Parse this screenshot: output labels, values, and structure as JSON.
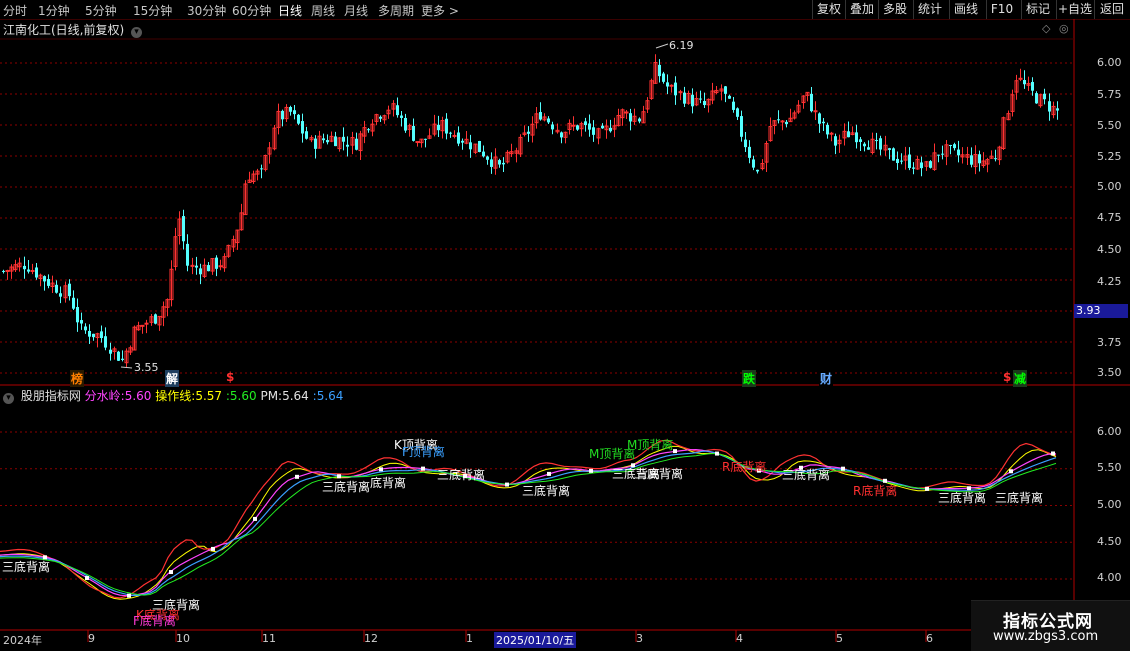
{
  "toolbar": {
    "periods": [
      "分时",
      "1分钟",
      "5分钟",
      "15分钟",
      "30分钟",
      "60分钟",
      "日线",
      "周线",
      "月线",
      "多周期",
      "更多 >"
    ],
    "active_period": "日线",
    "right_buttons": [
      "复权",
      "叠加",
      "多股",
      "统计",
      "画线",
      "F10",
      "标记",
      "+自选",
      "返回"
    ]
  },
  "main_panel": {
    "title": "江南化工(日线,前复权)",
    "price_labels": [
      "6.00",
      "5.75",
      "5.50",
      "5.25",
      "5.00",
      "4.75",
      "4.50",
      "4.25",
      "3.75",
      "3.50"
    ],
    "current_price": "3.93",
    "high_marker": "6.19",
    "low_marker": "3.55",
    "events": [
      {
        "text": "榜",
        "color": "#ff7f00",
        "bg": "#2a1a00"
      },
      {
        "text": "解",
        "color": "#ffffff",
        "bg": "#1f3f5f"
      },
      {
        "text": "$",
        "color": "#ff3030",
        "bg": "#000000"
      },
      {
        "text": "跌",
        "color": "#00ff00",
        "bg": "#1a3a1a"
      },
      {
        "text": "财",
        "color": "#66aaff",
        "bg": "#000000"
      },
      {
        "text": "$",
        "color": "#ff3030",
        "bg": "#000000"
      },
      {
        "text": "减",
        "color": "#00ff00",
        "bg": "#1a3a1a"
      }
    ]
  },
  "indicator_panel": {
    "name": "股朋指标网",
    "fsl_label": "分水岭:",
    "fsl_value": "5.60",
    "czx_label": "操作线:",
    "czx_value1": "5.57",
    "czx_sep": ":",
    "czx_value2": "5.60",
    "pm_label": "PM:",
    "pm_value1": "5.64",
    "pm_sep": ":",
    "pm_value2": "5.64",
    "y_labels": [
      "6.00",
      "5.50",
      "5.00",
      "4.50",
      "4.00"
    ],
    "divergence_labels": [
      {
        "text": "三底背离",
        "color": "#ffffff"
      },
      {
        "text": "三底背离",
        "color": "#ffffff"
      },
      {
        "text": "K底背离",
        "color": "#ff3030"
      },
      {
        "text": "F底背离",
        "color": "#ff3ad6"
      },
      {
        "text": "三底背离",
        "color": "#ffffff"
      },
      {
        "text": "K顶背离",
        "color": "#ffffff"
      },
      {
        "text": "F顶背离",
        "color": "#3aa0ff"
      },
      {
        "text": "底背离",
        "color": "#ffffff"
      },
      {
        "text": "三底背离",
        "color": "#ffffff"
      },
      {
        "text": "三底背离",
        "color": "#ffffff"
      },
      {
        "text": "M顶背离",
        "color": "#22dd22"
      },
      {
        "text": "M顶背离",
        "color": "#22dd22"
      },
      {
        "text": "三底背离",
        "color": "#ffffff"
      },
      {
        "text": "三底背离",
        "color": "#ffffff"
      },
      {
        "text": "R底背离",
        "color": "#ff3030"
      },
      {
        "text": "三底背离",
        "color": "#ffffff"
      },
      {
        "text": "R底背离",
        "color": "#ff3030"
      },
      {
        "text": "三底背离",
        "color": "#ffffff"
      },
      {
        "text": "三底背离",
        "color": "#ffffff"
      }
    ]
  },
  "x_axis": {
    "labels": [
      "2024年",
      "9",
      "10",
      "11",
      "12",
      "1",
      "2025/01/10/五",
      "3",
      "4",
      "5",
      "6"
    ]
  },
  "watermark": {
    "line1": "指标公式网",
    "line2": "www.zbgs3.com"
  },
  "colors": {
    "up": "#ff3232",
    "down": "#54ffff",
    "grid": "#8b0000",
    "panel_border": "#b00000",
    "fsl": "#ff44ff",
    "czx": "#ffff00",
    "pm": "#3aa0ff"
  },
  "chart_data": {
    "type": "candlestick",
    "price_range": [
      3.45,
      6.25
    ],
    "indicator_range": [
      3.85,
      6.35
    ]
  }
}
